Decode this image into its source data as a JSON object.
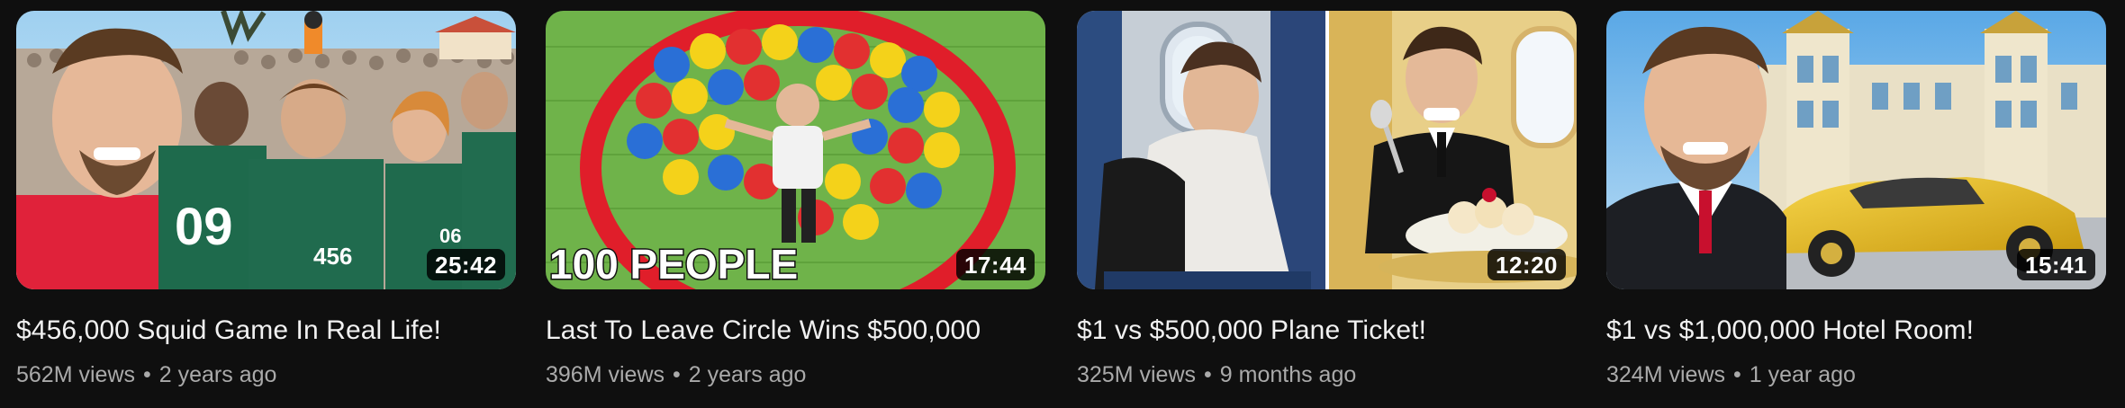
{
  "videos": [
    {
      "title": "$456,000 Squid Game In Real Life!",
      "views": "562M views",
      "age": "2 years ago",
      "duration": "25:42",
      "thumbnail_text": [
        "09",
        "456",
        "067"
      ]
    },
    {
      "title": "Last To Leave Circle Wins $500,000",
      "views": "396M views",
      "age": "2 years ago",
      "duration": "17:44",
      "thumbnail_text": [
        "100 PEOPLE"
      ]
    },
    {
      "title": "$1 vs $500,000 Plane Ticket!",
      "views": "325M views",
      "age": "9 months ago",
      "duration": "12:20",
      "thumbnail_text": []
    },
    {
      "title": "$1 vs $1,000,000 Hotel Room!",
      "views": "324M views",
      "age": "1 year ago",
      "duration": "15:41",
      "thumbnail_text": []
    }
  ],
  "separator": "•",
  "colors": {
    "background": "#0f0f0f",
    "title_text": "#f1f1f1",
    "meta_text": "#aaaaaa",
    "duration_badge": "#000000"
  }
}
